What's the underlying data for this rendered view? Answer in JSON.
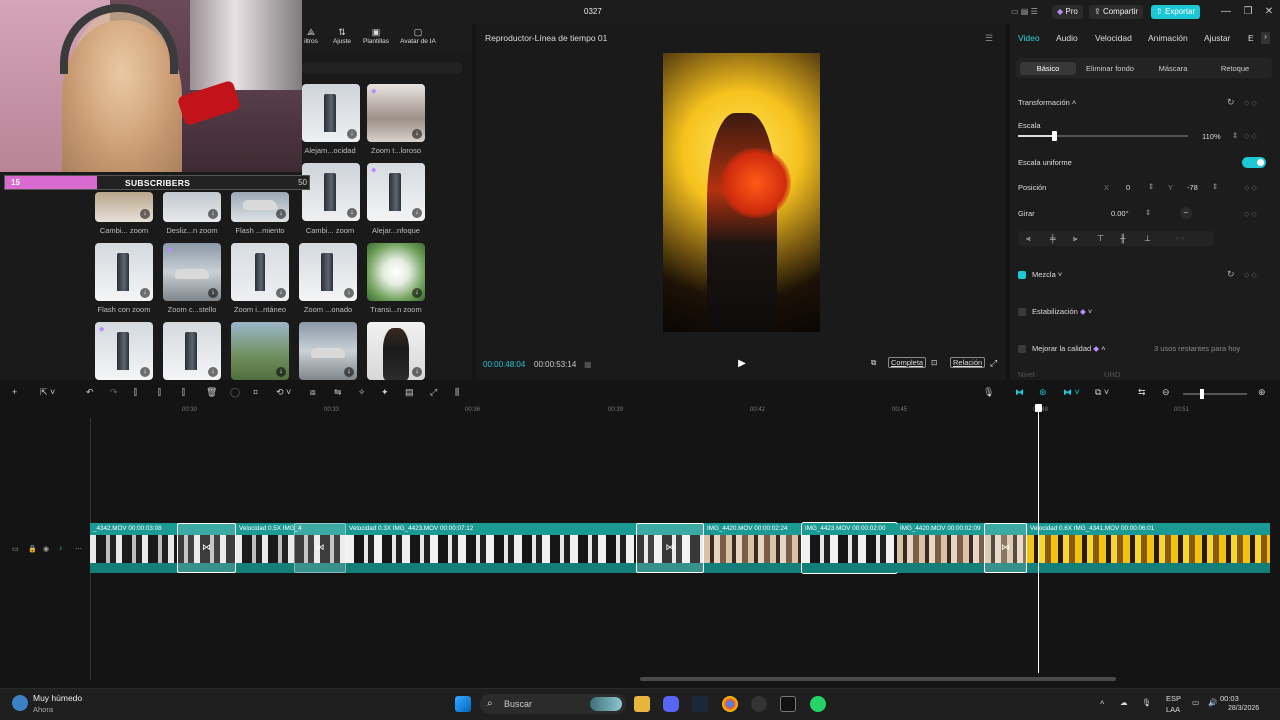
{
  "titlebar": {
    "project_name": "0327",
    "pro_label": "Pro",
    "share_label": "Compartir",
    "export_label": "Exportar",
    "minimize": "—",
    "maximize": "❐",
    "close": "✕",
    "accent": "#1cc8d4"
  },
  "tools": [
    {
      "label": "iltros",
      "icon": "filters-icon"
    },
    {
      "label": "Ajuste",
      "icon": "adjust-icon"
    },
    {
      "label": "Plantillas",
      "icon": "templates-icon"
    },
    {
      "label": "Avatar de IA",
      "icon": "avatar-icon"
    }
  ],
  "webcam_overlay": {
    "subscriber_count": "15",
    "subscriber_title": "SUBSCRIBERS",
    "subscriber_goal": "50"
  },
  "media": {
    "tiles": [
      {
        "label": "Alejam...ocidad"
      },
      {
        "label": "Zoom t...loroso"
      },
      {
        "label": "Cambi... zoom"
      },
      {
        "label": "Desliz...n zoom"
      },
      {
        "label": "Flash ...miento"
      },
      {
        "label": "Cambi... zoom"
      },
      {
        "label": "Alejar...nfoque"
      },
      {
        "label": "Flash con zoom"
      },
      {
        "label": "Zoom c...stello"
      },
      {
        "label": "Zoom i...ntáneo"
      },
      {
        "label": "Zoom ...onado"
      },
      {
        "label": "Transi...n zoom"
      },
      {
        "label": ""
      },
      {
        "label": ""
      },
      {
        "label": ""
      },
      {
        "label": ""
      },
      {
        "label": ""
      }
    ]
  },
  "player": {
    "title": "Reproductor-Línea de tiempo 01",
    "timecode_current": "00:00:48:04",
    "timecode_total": "00:00:53:14",
    "complete_label": "Completa",
    "ratio_label": "Relación"
  },
  "properties": {
    "tabs": [
      "Video",
      "Audio",
      "Velocidad",
      "Animación",
      "Ajustar",
      "E"
    ],
    "subtabs": [
      "Básico",
      "Eliminar fondo",
      "Máscara",
      "Retoque"
    ],
    "section_transform": "Transformación",
    "scale_label": "Escala",
    "scale_value": "110%",
    "scale_fraction": 0.21,
    "uniform_scale_label": "Escala uniforme",
    "position_label": "Posición",
    "pos_x_label": "X",
    "pos_x": "0",
    "pos_y_label": "Y",
    "pos_y": "-78",
    "rotate_label": "Girar",
    "rotate_value": "0.00°",
    "blend_label": "Mezcla",
    "stabilization_label": "Estabilización",
    "quality_label": "Mejorar la calidad",
    "quality_uses": "3 usos restantes para hoy",
    "level_label": "Nivel",
    "level_value": "UHD"
  },
  "timeline": {
    "ruler": [
      "00:30",
      "00:33",
      "00:36",
      "00:39",
      "00:42",
      "00:45",
      "00:48",
      "00:51"
    ],
    "clips": [
      {
        "label": "_4342.MOV  00:00:03:08",
        "style": "dark"
      },
      {
        "label": "Velocidad 0.5X  IMG_4",
        "style": "dark"
      },
      {
        "label": "Velocidad 0.3X  IMG_4423.MOV  00:00:07:12",
        "style": "boots"
      },
      {
        "label": "IMG_4420.MOV  00:00:02:24",
        "style": "girl"
      },
      {
        "label": "IMG_4423.MOV  00:00:02:00",
        "style": "boots"
      },
      {
        "label": "IMG_4420.MOV  00:00:02:09",
        "style": "girl"
      },
      {
        "label": "Velocidad 0.6X  IMG_4341.MOV  00:00:06:01",
        "style": "yellow"
      }
    ]
  },
  "taskbar": {
    "weather_title": "Muy húmedo",
    "weather_sub": "Ahora",
    "search_placeholder": "Buscar",
    "lang_top": "ESP",
    "lang_bottom": "LAA",
    "time": "00:03",
    "date": "28/3/2026"
  }
}
